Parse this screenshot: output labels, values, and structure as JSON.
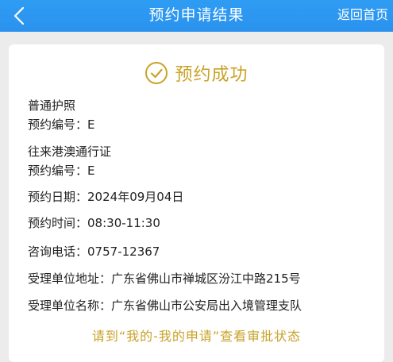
{
  "header": {
    "title": "预约申请结果",
    "home_label": "返回首页"
  },
  "result": {
    "status_text": "预约成功",
    "status_color": "#c9a227",
    "items": [
      {
        "doc_type": "普通护照",
        "number_label": "预约编号：",
        "number_value": "E"
      },
      {
        "doc_type": "往来港澳通行证",
        "number_label": "预约编号：",
        "number_value": "E"
      }
    ],
    "date_label": "预约日期：",
    "date_value": "2024年09月04日",
    "time_label": "预约时间：",
    "time_value": "08:30-11:30",
    "phone_label": "咨询电话：",
    "phone_value": "0757-12367",
    "address_label": "受理单位地址：",
    "address_value": "广东省佛山市禅城区汾江中路215号",
    "unit_label": "受理单位名称：",
    "unit_value": "广东省佛山市公安局出入境管理支队",
    "footer_note": "请到“我的-我的申请”查看审批状态"
  },
  "theme": {
    "header_color": "#2f9cf3",
    "accent_color": "#c9a227"
  },
  "icons": {
    "back": "chevron-left-icon",
    "success": "check-circle-icon"
  }
}
